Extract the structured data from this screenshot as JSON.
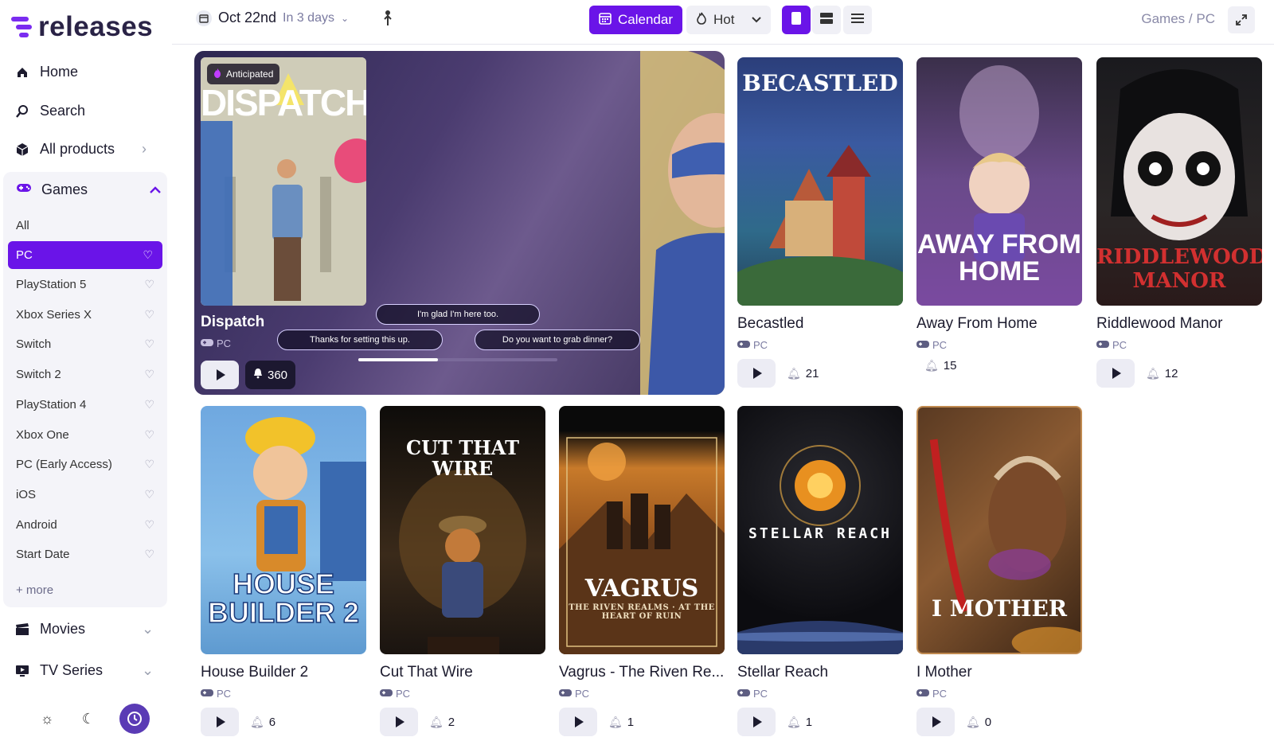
{
  "app": {
    "logo_text": "releases",
    "accent": "#6a14e8"
  },
  "sidebar": {
    "nav": [
      {
        "label": "Home",
        "icon": "home-icon"
      },
      {
        "label": "Search",
        "icon": "search-icon"
      },
      {
        "label": "All products",
        "icon": "box-icon"
      }
    ],
    "games": {
      "label": "Games",
      "platforms": [
        "All",
        "PC",
        "PlayStation 5",
        "Xbox Series X",
        "Switch",
        "Switch 2",
        "PlayStation 4",
        "Xbox One",
        "PC (Early Access)",
        "iOS",
        "Android",
        "Start Date"
      ],
      "active": "PC",
      "more": "+ more"
    },
    "movies": "Movies",
    "tv": "TV Series"
  },
  "topbar": {
    "date": "Oct 22nd",
    "date_sub": "In 3 days",
    "calendar_label": "Calendar",
    "hot_label": "Hot",
    "breadcrumb_a": "Games",
    "breadcrumb_sep": "/",
    "breadcrumb_b": "PC"
  },
  "feature": {
    "badge": "Anticipated",
    "title": "Dispatch",
    "platform": "PC",
    "count": "360",
    "bubbles": [
      "I'm glad I'm here too.",
      "Thanks for setting this up.",
      "Do you want to grab dinner?"
    ],
    "poster_text": "DISPATCH"
  },
  "cards": [
    {
      "title": "Becastled",
      "platform": "PC",
      "count": "21",
      "cover_text": "BECASTLED",
      "showPlayBg": true
    },
    {
      "title": "Away From Home",
      "platform": "PC",
      "count": "15",
      "cover_text": "AWAY FROM HOME",
      "showPlayBg": false
    },
    {
      "title": "Riddlewood Manor",
      "platform": "PC",
      "count": "12",
      "cover_text": "RIDDLEWOOD MANOR",
      "showPlayBg": true
    },
    {
      "title": "House Builder 2",
      "platform": "PC",
      "count": "6",
      "cover_text": "HOUSE BUILDER 2",
      "showPlayBg": true
    },
    {
      "title": "Cut That Wire",
      "platform": "PC",
      "count": "2",
      "cover_text": "CUT THAT WIRE",
      "showPlayBg": true
    },
    {
      "title": "Vagrus - The Riven Re...",
      "platform": "PC",
      "count": "1",
      "cover_text": "VAGRUS",
      "cover_sub": "THE RIVEN REALMS · AT THE HEART OF RUIN",
      "showPlayBg": true
    },
    {
      "title": "Stellar Reach",
      "platform": "PC",
      "count": "1",
      "cover_text": "STELLAR REACH",
      "showPlayBg": true
    },
    {
      "title": "I Mother",
      "platform": "PC",
      "count": "0",
      "cover_text": "I MOTHER",
      "showPlayBg": true
    }
  ]
}
